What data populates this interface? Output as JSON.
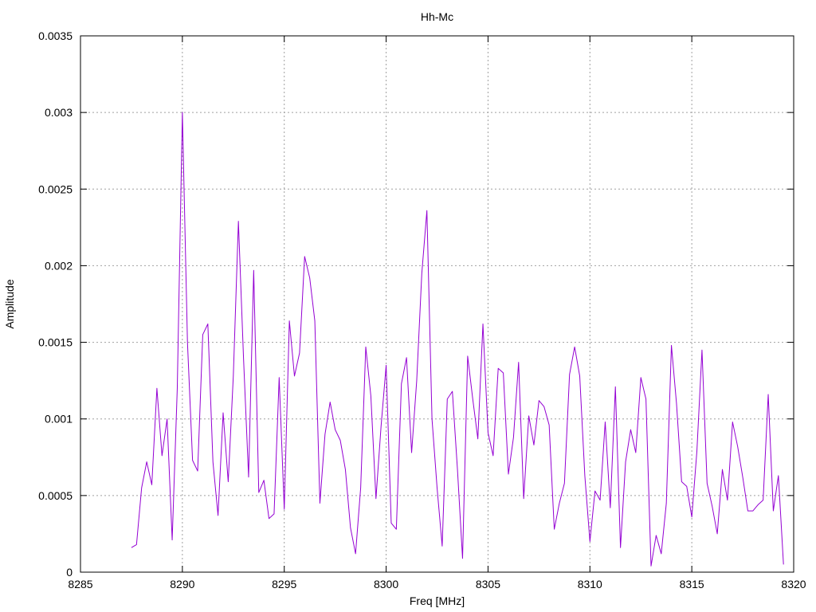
{
  "chart_data": {
    "type": "line",
    "title": "Hh-Mc",
    "xlabel": "Freq [MHz]",
    "ylabel": "Amplitude",
    "xlim": [
      8285,
      8320
    ],
    "ylim": [
      0,
      0.0035
    ],
    "xticks": [
      8285,
      8290,
      8295,
      8300,
      8305,
      8310,
      8315,
      8320
    ],
    "xtick_labels": [
      "8285",
      "8290",
      "8295",
      "8300",
      "8305",
      "8310",
      "8315",
      "8320"
    ],
    "yticks": [
      0,
      0.0005,
      0.001,
      0.0015,
      0.002,
      0.0025,
      0.003,
      0.0035
    ],
    "ytick_labels": [
      "0",
      "0.0005",
      "0.001",
      "0.0015",
      "0.002",
      "0.0025",
      "0.003",
      "0.0035"
    ],
    "grid": true,
    "legend": "none",
    "series": [
      {
        "color": "#9400D3",
        "x": [
          8287.5,
          8287.75,
          8288.0,
          8288.25,
          8288.5,
          8288.75,
          8289.0,
          8289.25,
          8289.5,
          8289.75,
          8290.0,
          8290.25,
          8290.5,
          8290.75,
          8291.0,
          8291.25,
          8291.5,
          8291.75,
          8292.0,
          8292.25,
          8292.5,
          8292.75,
          8293.0,
          8293.25,
          8293.5,
          8293.75,
          8294.0,
          8294.25,
          8294.5,
          8294.75,
          8295.0,
          8295.25,
          8295.5,
          8295.75,
          8296.0,
          8296.25,
          8296.5,
          8296.75,
          8297.0,
          8297.25,
          8297.5,
          8297.75,
          8298.0,
          8298.25,
          8298.5,
          8298.75,
          8299.0,
          8299.25,
          8299.5,
          8299.75,
          8300.0,
          8300.25,
          8300.5,
          8300.75,
          8301.0,
          8301.25,
          8301.5,
          8301.75,
          8302.0,
          8302.25,
          8302.5,
          8302.75,
          8303.0,
          8303.25,
          8303.5,
          8303.75,
          8304.0,
          8304.25,
          8304.5,
          8304.75,
          8305.0,
          8305.25,
          8305.5,
          8305.75,
          8306.0,
          8306.25,
          8306.5,
          8306.75,
          8307.0,
          8307.25,
          8307.5,
          8307.75,
          8308.0,
          8308.25,
          8308.5,
          8308.75,
          8309.0,
          8309.25,
          8309.5,
          8309.75,
          8310.0,
          8310.25,
          8310.5,
          8310.75,
          8311.0,
          8311.25,
          8311.5,
          8311.75,
          8312.0,
          8312.25,
          8312.5,
          8312.75,
          8313.0,
          8313.25,
          8313.5,
          8313.75,
          8314.0,
          8314.25,
          8314.5,
          8314.75,
          8315.0,
          8315.25,
          8315.5,
          8315.75,
          8316.0,
          8316.25,
          8316.5,
          8316.75,
          8317.0,
          8317.25,
          8317.5,
          8317.75,
          8318.0,
          8318.25,
          8318.5,
          8318.75,
          8319.0,
          8319.25,
          8319.5
        ],
        "y": [
          0.00016,
          0.00018,
          0.00055,
          0.00072,
          0.00057,
          0.0012,
          0.00076,
          0.001,
          0.00021,
          0.0012,
          0.003,
          0.0015,
          0.00073,
          0.00066,
          0.00155,
          0.00162,
          0.00072,
          0.00037,
          0.00104,
          0.00059,
          0.00128,
          0.00229,
          0.0014,
          0.00062,
          0.00197,
          0.00052,
          0.0006,
          0.00035,
          0.00038,
          0.00127,
          0.00041,
          0.00164,
          0.00128,
          0.00143,
          0.00206,
          0.00192,
          0.00164,
          0.00045,
          0.0009,
          0.00111,
          0.00093,
          0.00086,
          0.00067,
          0.00029,
          0.00012,
          0.00055,
          0.00147,
          0.00115,
          0.00048,
          0.00095,
          0.00135,
          0.00032,
          0.00028,
          0.00123,
          0.0014,
          0.00078,
          0.00125,
          0.00195,
          0.00236,
          0.001,
          0.00055,
          0.00017,
          0.00113,
          0.00118,
          0.00067,
          9e-05,
          0.00141,
          0.00113,
          0.00087,
          0.00162,
          0.00091,
          0.00076,
          0.00133,
          0.0013,
          0.00064,
          0.00088,
          0.00137,
          0.00048,
          0.00102,
          0.00083,
          0.00112,
          0.00108,
          0.00096,
          0.00028,
          0.00045,
          0.00058,
          0.00129,
          0.00147,
          0.00128,
          0.00063,
          0.0002,
          0.00053,
          0.00047,
          0.00098,
          0.00042,
          0.00121,
          0.00016,
          0.00072,
          0.00093,
          0.00078,
          0.00127,
          0.00113,
          4e-05,
          0.00024,
          0.00012,
          0.00045,
          0.00148,
          0.0011,
          0.00059,
          0.00056,
          0.00036,
          0.00079,
          0.00145,
          0.00058,
          0.00043,
          0.00025,
          0.00067,
          0.00047,
          0.00098,
          0.00082,
          0.00062,
          0.0004,
          0.0004,
          0.00044,
          0.00047,
          0.00116,
          0.0004,
          0.00063,
          5e-05
        ]
      }
    ]
  }
}
